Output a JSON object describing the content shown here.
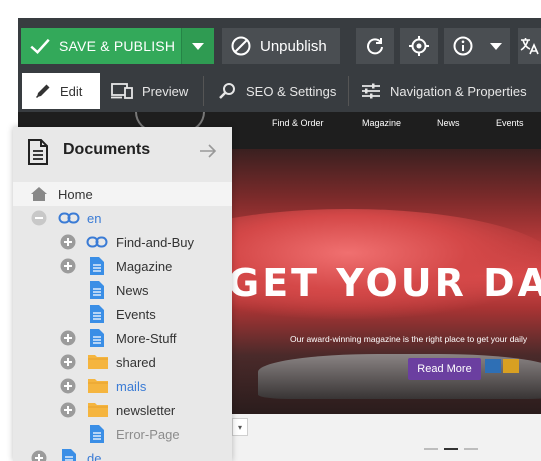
{
  "toolbar": {
    "save_label": "SAVE & PUBLISH",
    "unpublish_label": "Unpublish",
    "colors": {
      "save": "#33a95a",
      "bar": "#383c40",
      "button": "#4a4e52"
    }
  },
  "tabs": [
    {
      "label": "Edit",
      "icon": "pencil-icon"
    },
    {
      "label": "Preview",
      "icon": "devices-icon"
    },
    {
      "label": "SEO & Settings",
      "icon": "search-icon"
    },
    {
      "label": "Navigation & Properties",
      "icon": "sliders-icon"
    }
  ],
  "site": {
    "nav": [
      "Find & Order",
      "Magazine",
      "News",
      "Events"
    ],
    "headline": "GET YOUR DAILY",
    "subline": "Our award-winning magazine is the right place to get your daily",
    "read_more": "Read More"
  },
  "tree": {
    "title": "Documents",
    "items": [
      {
        "label": "Home",
        "type": "home"
      },
      {
        "label": "en",
        "type": "link"
      },
      {
        "label": "Find-and-Buy",
        "type": "link"
      },
      {
        "label": "Magazine",
        "type": "page"
      },
      {
        "label": "News",
        "type": "page"
      },
      {
        "label": "Events",
        "type": "page"
      },
      {
        "label": "More-Stuff",
        "type": "page"
      },
      {
        "label": "shared",
        "type": "folder"
      },
      {
        "label": "mails",
        "type": "folder"
      },
      {
        "label": "newsletter",
        "type": "folder"
      },
      {
        "label": "Error-Page",
        "type": "page"
      },
      {
        "label": "de",
        "type": "page"
      }
    ]
  }
}
